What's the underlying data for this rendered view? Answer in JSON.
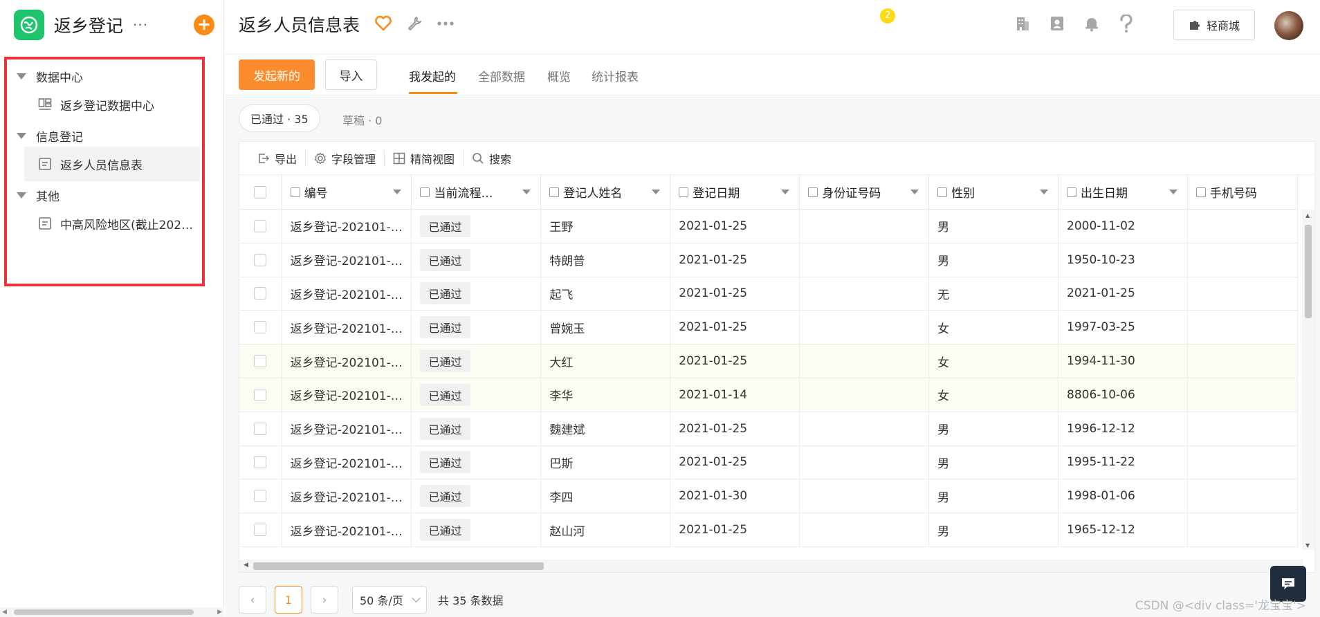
{
  "app": {
    "name": "返乡登记",
    "more": "···",
    "add": "+"
  },
  "sidebar": {
    "groups": [
      {
        "label": "数据中心",
        "items": [
          {
            "label": "返乡登记数据中心"
          }
        ]
      },
      {
        "label": "信息登记",
        "items": [
          {
            "label": "返乡人员信息表"
          }
        ]
      },
      {
        "label": "其他",
        "items": [
          {
            "label": "中高风险地区(截止202…"
          }
        ]
      }
    ]
  },
  "header": {
    "title": "返乡人员信息表",
    "notification_count": "2",
    "mall_label": "轻商城"
  },
  "actions": {
    "new_label": "发起新的",
    "import_label": "导入",
    "tabs": [
      "我发起的",
      "全部数据",
      "概览",
      "统计报表"
    ]
  },
  "filters": {
    "approved": "已通过 · 35",
    "draft": "草稿 · 0"
  },
  "toolbar": {
    "export": "导出",
    "fields": "字段管理",
    "simple_view": "精简视图",
    "search": "搜索"
  },
  "table": {
    "columns": [
      "编号",
      "当前流程…",
      "登记人姓名",
      "登记日期",
      "身份证号码",
      "性别",
      "出生日期",
      "手机号码"
    ],
    "rows": [
      {
        "id": "返乡登记-202101-…",
        "status": "已通过",
        "name": "王野",
        "date": "2021-01-25",
        "idcard": "",
        "gender": "男",
        "birth": "2000-11-02",
        "phone": ""
      },
      {
        "id": "返乡登记-202101-…",
        "status": "已通过",
        "name": "特朗普",
        "date": "2021-01-25",
        "idcard": "",
        "gender": "男",
        "birth": "1950-10-23",
        "phone": ""
      },
      {
        "id": "返乡登记-202101-…",
        "status": "已通过",
        "name": "起飞",
        "date": "2021-01-25",
        "idcard": "",
        "gender": "无",
        "birth": "2021-01-25",
        "phone": ""
      },
      {
        "id": "返乡登记-202101-…",
        "status": "已通过",
        "name": "曾婉玉",
        "date": "2021-01-25",
        "idcard": "",
        "gender": "女",
        "birth": "1997-03-25",
        "phone": ""
      },
      {
        "id": "返乡登记-202101-…",
        "status": "已通过",
        "name": "大红",
        "date": "2021-01-25",
        "idcard": "",
        "gender": "女",
        "birth": "1994-11-30",
        "phone": ""
      },
      {
        "id": "返乡登记-202101-…",
        "status": "已通过",
        "name": "李华",
        "date": "2021-01-14",
        "idcard": "",
        "gender": "女",
        "birth": "8806-10-06",
        "phone": ""
      },
      {
        "id": "返乡登记-202101-…",
        "status": "已通过",
        "name": "魏建斌",
        "date": "2021-01-25",
        "idcard": "",
        "gender": "男",
        "birth": "1996-12-12",
        "phone": ""
      },
      {
        "id": "返乡登记-202101-…",
        "status": "已通过",
        "name": "巴斯",
        "date": "2021-01-25",
        "idcard": "",
        "gender": "男",
        "birth": "1995-11-22",
        "phone": ""
      },
      {
        "id": "返乡登记-202101-…",
        "status": "已通过",
        "name": "李四",
        "date": "2021-01-30",
        "idcard": "",
        "gender": "男",
        "birth": "1998-01-06",
        "phone": ""
      },
      {
        "id": "返乡登记-202101-…",
        "status": "已通过",
        "name": "赵山河",
        "date": "2021-01-25",
        "idcard": "",
        "gender": "男",
        "birth": "1965-12-12",
        "phone": ""
      }
    ]
  },
  "pager": {
    "current": "1",
    "page_size": "50 条/页",
    "total": "共 35 条数据"
  },
  "watermark": "CSDN @<div class='龙宝宝'>",
  "colors": {
    "accent": "#fa8c16",
    "app_logo": "#1fc46c",
    "highlight_box": "#e8353b"
  }
}
